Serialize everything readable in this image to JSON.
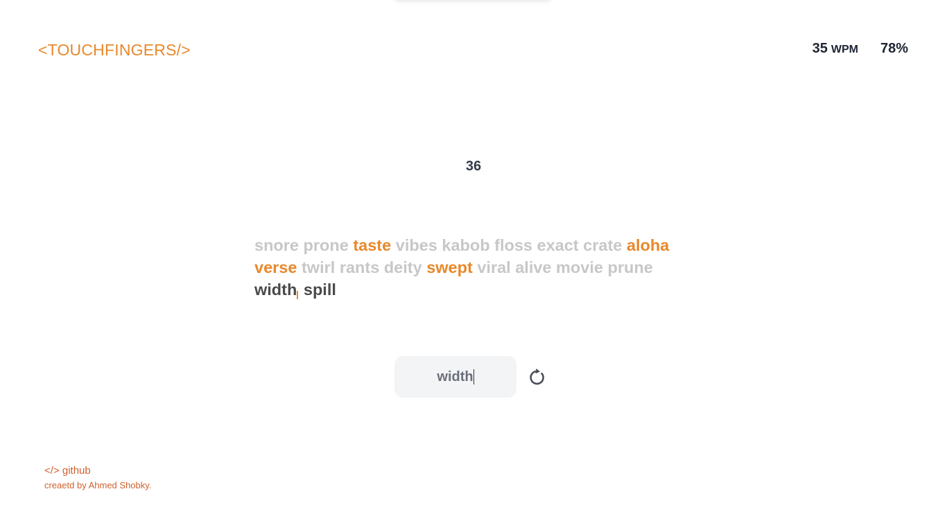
{
  "header": {
    "logo": "<TOUCHFINGERS/>",
    "wpm_value": "35",
    "wpm_unit": "WPM",
    "accuracy": "78%"
  },
  "timer": "36",
  "words": {
    "line1": [
      "snore",
      "prone",
      "taste",
      "vibes",
      "kabob",
      "floss",
      "exact",
      "crate",
      "aloha"
    ],
    "line1_states": [
      "pending",
      "pending",
      "orange",
      "pending",
      "pending",
      "pending",
      "pending",
      "pending",
      "orange"
    ],
    "line2": [
      "verse",
      "twirl",
      "rants",
      "deity",
      "swept",
      "viral",
      "alive",
      "movie",
      "prune"
    ],
    "line2_states": [
      "orange",
      "pending",
      "pending",
      "pending",
      "orange",
      "pending",
      "pending",
      "pending",
      "pending"
    ],
    "line3": [
      "width",
      "spill"
    ],
    "line3_states": [
      "current",
      "current"
    ]
  },
  "typing_input": {
    "value": "width"
  },
  "reset": {
    "icon": "refresh-icon"
  },
  "footer": {
    "github": "</> github",
    "credit": "creaetd by Ahmed Shobky."
  },
  "colors": {
    "accent": "#e8882b",
    "pending": "#c7c7c7",
    "current": "#4a4a4a",
    "footer": "#d0602e"
  }
}
